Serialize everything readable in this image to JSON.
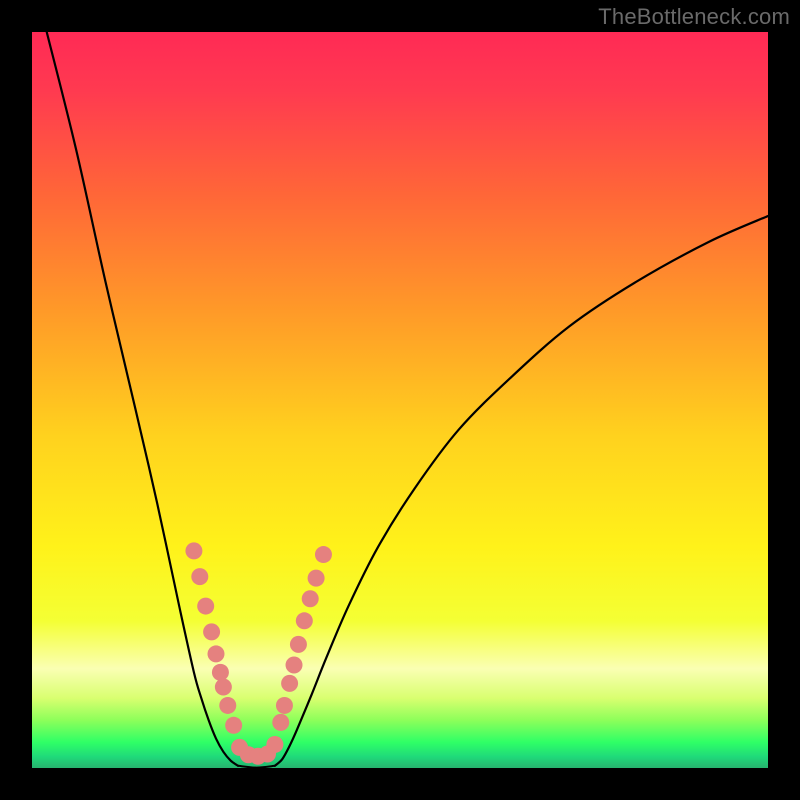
{
  "watermark": "TheBottleneck.com",
  "chart_data": {
    "type": "line",
    "title": "",
    "xlabel": "",
    "ylabel": "",
    "xlim": [
      0,
      100
    ],
    "ylim": [
      0,
      100
    ],
    "grid": false,
    "legend": false,
    "series": [
      {
        "name": "left-curve",
        "x": [
          2,
          6,
          10,
          14,
          17,
          20,
          22,
          23,
          24,
          25,
          26,
          27,
          28
        ],
        "y": [
          100,
          84,
          66,
          49,
          36,
          22,
          13,
          9.5,
          6.5,
          4,
          2.2,
          1,
          0.3
        ]
      },
      {
        "name": "right-curve",
        "x": [
          33,
          34,
          35,
          36,
          38,
          40,
          43,
          47,
          52,
          58,
          65,
          73,
          82,
          92,
          100
        ],
        "y": [
          0.3,
          1.2,
          3,
          5.2,
          10,
          15,
          22,
          30,
          38,
          46,
          53,
          60,
          66,
          71.5,
          75
        ]
      },
      {
        "name": "valley-floor",
        "x": [
          28,
          30.5,
          33
        ],
        "y": [
          0.3,
          0.05,
          0.3
        ]
      }
    ],
    "markers": [
      {
        "series": "left-curve-dots",
        "color": "#e5817f",
        "points": [
          {
            "x": 22.0,
            "y": 29.5
          },
          {
            "x": 22.8,
            "y": 26.0
          },
          {
            "x": 23.6,
            "y": 22.0
          },
          {
            "x": 24.4,
            "y": 18.5
          },
          {
            "x": 25.0,
            "y": 15.5
          },
          {
            "x": 25.6,
            "y": 13.0
          },
          {
            "x": 26.0,
            "y": 11.0
          },
          {
            "x": 26.6,
            "y": 8.5
          },
          {
            "x": 27.4,
            "y": 5.8
          }
        ]
      },
      {
        "series": "right-curve-dots",
        "color": "#e5817f",
        "points": [
          {
            "x": 33.8,
            "y": 6.2
          },
          {
            "x": 34.3,
            "y": 8.5
          },
          {
            "x": 35.0,
            "y": 11.5
          },
          {
            "x": 35.6,
            "y": 14.0
          },
          {
            "x": 36.2,
            "y": 16.8
          },
          {
            "x": 37.0,
            "y": 20.0
          },
          {
            "x": 37.8,
            "y": 23.0
          },
          {
            "x": 38.6,
            "y": 25.8
          },
          {
            "x": 39.6,
            "y": 29.0
          }
        ]
      },
      {
        "series": "valley-dots",
        "color": "#e5817f",
        "points": [
          {
            "x": 28.2,
            "y": 2.8
          },
          {
            "x": 29.4,
            "y": 1.8
          },
          {
            "x": 30.7,
            "y": 1.6
          },
          {
            "x": 32.0,
            "y": 1.9
          },
          {
            "x": 33.0,
            "y": 3.2
          }
        ]
      }
    ],
    "background_gradient": {
      "stops": [
        {
          "offset": 0.0,
          "color": "#ff2a55"
        },
        {
          "offset": 0.08,
          "color": "#ff3a50"
        },
        {
          "offset": 0.22,
          "color": "#ff6638"
        },
        {
          "offset": 0.38,
          "color": "#ff9a28"
        },
        {
          "offset": 0.55,
          "color": "#ffd21e"
        },
        {
          "offset": 0.7,
          "color": "#fff21a"
        },
        {
          "offset": 0.8,
          "color": "#f4ff34"
        },
        {
          "offset": 0.865,
          "color": "#faffb3"
        },
        {
          "offset": 0.905,
          "color": "#d9ff70"
        },
        {
          "offset": 0.935,
          "color": "#8dff5a"
        },
        {
          "offset": 0.965,
          "color": "#2fff66"
        },
        {
          "offset": 0.985,
          "color": "#1fd97a"
        },
        {
          "offset": 1.0,
          "color": "#27b36f"
        }
      ]
    }
  }
}
